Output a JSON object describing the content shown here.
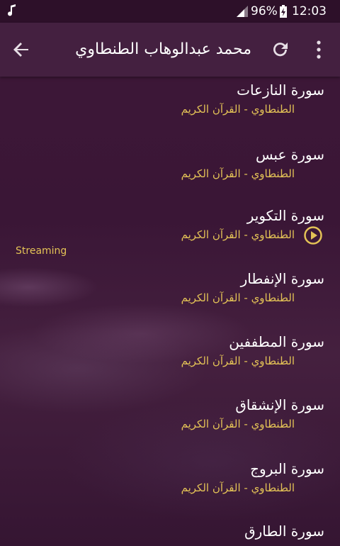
{
  "status_bar": {
    "battery": "96%",
    "time": "12:03"
  },
  "app_bar": {
    "title": "محمد عبدالوهاب الطنطاوي"
  },
  "streaming_label": "Streaming",
  "list": {
    "items": [
      {
        "title": "سورة النازعات",
        "subtitle": "الطنطاوي - القرآن الكريم",
        "playing": false
      },
      {
        "title": "سورة عبس",
        "subtitle": "الطنطاوي - القرآن الكريم",
        "playing": false
      },
      {
        "title": "سورة التكوير",
        "subtitle": "الطنطاوي - القرآن الكريم",
        "playing": true
      },
      {
        "title": "سورة الإنفطار",
        "subtitle": "الطنطاوي - القرآن الكريم",
        "playing": false
      },
      {
        "title": "سورة المطففين",
        "subtitle": "الطنطاوي - القرآن الكريم",
        "playing": false
      },
      {
        "title": "سورة الإنشقاق",
        "subtitle": "الطنطاوي - القرآن الكريم",
        "playing": false
      },
      {
        "title": "سورة البروج",
        "subtitle": "الطنطاوي - القرآن الكريم",
        "playing": false
      },
      {
        "title": "سورة الطارق",
        "subtitle": "",
        "playing": false
      }
    ]
  },
  "colors": {
    "accent": "#e3c256",
    "app_bar": "#442040",
    "status_bar": "#2d1029",
    "background": "#3e1838"
  },
  "icons": {
    "status_left": "music-note-icon",
    "signal": "signal-icon",
    "battery": "battery-charging-icon",
    "back": "arrow-back-icon",
    "refresh": "refresh-icon",
    "menu": "more-vert-icon",
    "play": "play-circle-icon"
  }
}
